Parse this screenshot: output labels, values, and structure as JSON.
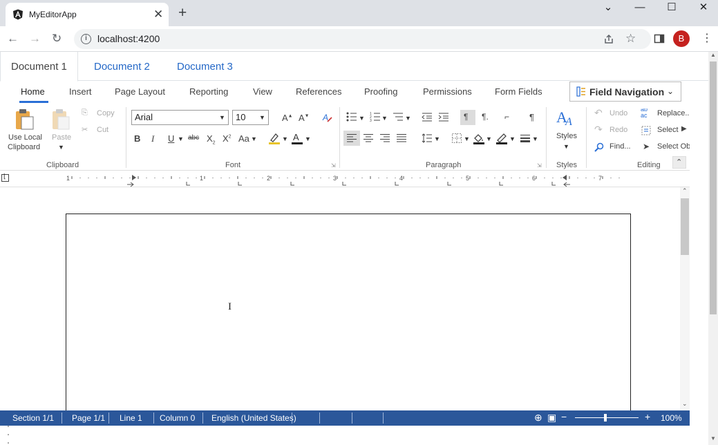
{
  "browser": {
    "tab_title": "MyEditorApp",
    "tab_close": "✕",
    "new_tab": "+",
    "url": "localhost:4200",
    "avatar_letter": "B",
    "window_controls": {
      "menu": "⌄",
      "minimize": "—",
      "maximize": "☐",
      "close": "✕"
    }
  },
  "documents": {
    "tabs": [
      "Document 1",
      "Document 2",
      "Document 3"
    ],
    "active_index": 0
  },
  "ribbon": {
    "tabs": [
      "Home",
      "Insert",
      "Page Layout",
      "Reporting",
      "View",
      "References",
      "Proofing",
      "Permissions",
      "Form Fields"
    ],
    "active": "Home",
    "field_navigation": "Field Navigation"
  },
  "clipboard": {
    "use_local": "Use Local",
    "clipboard_word": "Clipboard",
    "paste": "Paste",
    "copy": "Copy",
    "cut": "Cut",
    "group_label": "Clipboard"
  },
  "font": {
    "family": "Arial",
    "size": "10",
    "change_case": "Aa",
    "group_label": "Font"
  },
  "paragraph": {
    "group_label": "Paragraph"
  },
  "styles": {
    "label": "Styles",
    "group_label": "Styles"
  },
  "editing": {
    "undo": "Undo",
    "redo": "Redo",
    "find": "Find...",
    "replace": "Replace...",
    "select": "Select",
    "select_objects": "Select Ob",
    "group_label": "Editing"
  },
  "status": {
    "section": "Section 1/1",
    "page": "Page 1/1",
    "line": "Line 1",
    "column": "Column 0",
    "language": "English (United States)",
    "zoom": "100%",
    "zoom_level": 0.48
  },
  "colors": {
    "accent": "#2a6fd6",
    "status_bar": "#2b579a",
    "avatar": "#c5221f"
  }
}
